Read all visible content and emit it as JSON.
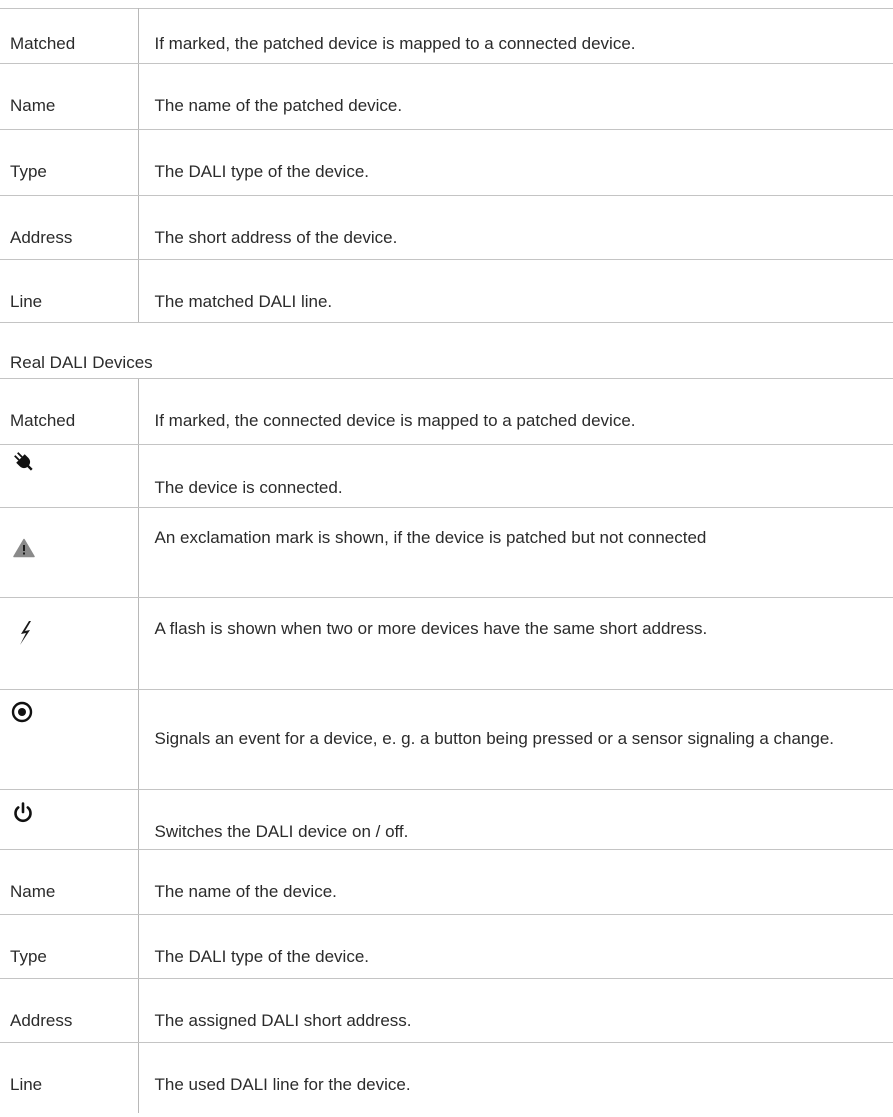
{
  "patched_rows": [
    {
      "term": "Matched",
      "desc": "If marked, the patched device is mapped to a connected device."
    },
    {
      "term": "Name",
      "desc": "The name of the patched device."
    },
    {
      "term": "Type",
      "desc": "The DALI type of the device."
    },
    {
      "term": "Address",
      "desc": "The short address of the device."
    },
    {
      "term": "Line",
      "desc": "The matched DALI line."
    }
  ],
  "section_title": "Real DALI Devices",
  "real_matched": {
    "term": "Matched",
    "desc": "If marked, the connected device is mapped to a patched device."
  },
  "icon_rows": [
    {
      "icon": "plug-icon",
      "desc": "The device is connected."
    },
    {
      "icon": "warning-triangle-icon",
      "desc": "An exclamation mark is shown, if the device is patched but not connected"
    },
    {
      "icon": "flash-icon",
      "desc": "A flash is shown when two or more devices have the same short address."
    },
    {
      "icon": "event-target-icon",
      "desc": "Signals an event for a device, e. g. a button being pressed or a sensor signaling a change."
    },
    {
      "icon": "power-icon",
      "desc": "Switches the DALI device on / off."
    }
  ],
  "real_rows": [
    {
      "term": "Name",
      "desc": "The name of the device."
    },
    {
      "term": "Type",
      "desc": "The DALI type of the device."
    },
    {
      "term": "Address",
      "desc": "The assigned DALI short address."
    },
    {
      "term": "Line",
      "desc": "The used DALI line for the device."
    }
  ]
}
